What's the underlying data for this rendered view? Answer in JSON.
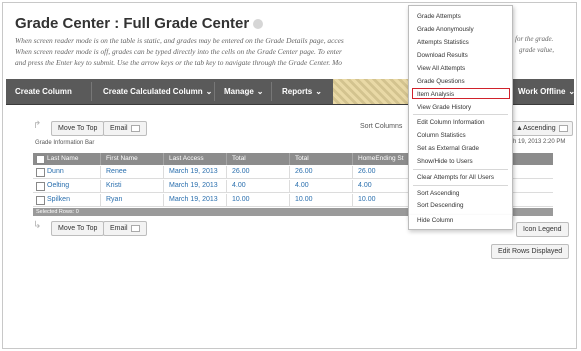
{
  "page": {
    "title": "Grade Center : Full Grade Center",
    "instructions": [
      "When screen reader mode is on the table is static, and grades may be entered on the Grade Details page, acces",
      "When screen reader mode is off, grades can be typed directly into the cells on the Grade Center page. To enter",
      "and press the Enter key to submit. Use the arrow keys or the tab key to navigate through the Grade Center. Mo"
    ],
    "instructions_tail": [
      "for the grade.",
      "grade value,"
    ]
  },
  "action_bar": {
    "items": [
      {
        "label": "Create Column"
      },
      {
        "label": "Create Calculated Column"
      },
      {
        "label": "Manage"
      },
      {
        "label": "Reports"
      },
      {
        "label": "Work Offline"
      }
    ]
  },
  "toolbar": {
    "move_to_top": "Move To Top",
    "email": "Email",
    "sort_columns_label": "Sort Columns",
    "ascending": "Ascending",
    "grade_info_bar": "Grade Information Bar",
    "last_saved": "h 19, 2013 2:20 PM"
  },
  "grid": {
    "headers": [
      "Last Name",
      "First Name",
      "Last Access",
      "Total",
      "Total",
      "HomeEnding St"
    ],
    "rows": [
      {
        "last": "Dunn",
        "first": "Renee",
        "access": "March 19, 2013",
        "total1": "26.00",
        "total2": "26.00",
        "home": "26.00"
      },
      {
        "last": "Oelting",
        "first": "Kristi",
        "access": "March 19, 2013",
        "total1": "4.00",
        "total2": "4.00",
        "home": "4.00"
      },
      {
        "last": "Spilken",
        "first": "Ryan",
        "access": "March 19, 2013",
        "total1": "10.00",
        "total2": "10.00",
        "home": "10.00"
      }
    ],
    "selected_rows": "Selected Rows: 0"
  },
  "bottom": {
    "move_to_top": "Move To Top",
    "email": "Email",
    "icon_legend": "Icon Legend",
    "edit_rows": "Edit Rows Displayed"
  },
  "context_menu": {
    "items": [
      {
        "label": "Grade Attempts"
      },
      {
        "label": "Grade Anonymously"
      },
      {
        "label": "Attempts Statistics"
      },
      {
        "label": "Download Results"
      },
      {
        "label": "View All Attempts"
      },
      {
        "label": "Grade Questions"
      },
      {
        "label": "Item Analysis",
        "highlighted": true
      },
      {
        "label": "View Grade History"
      },
      {
        "label": "Edit Column Information"
      },
      {
        "label": "Column Statistics"
      },
      {
        "label": "Set as External Grade"
      },
      {
        "label": "Show/Hide to Users"
      },
      {
        "label": "Clear Attempts for All Users"
      },
      {
        "label": "Sort Ascending"
      },
      {
        "label": "Sort Descending"
      },
      {
        "label": "Hide Column"
      }
    ]
  },
  "colors": {
    "action_bar_bg": "#5a5a5a",
    "grid_header_bg": "#8c8c8c",
    "link_blue": "#2a6fae",
    "highlight_red": "#d0222b"
  }
}
